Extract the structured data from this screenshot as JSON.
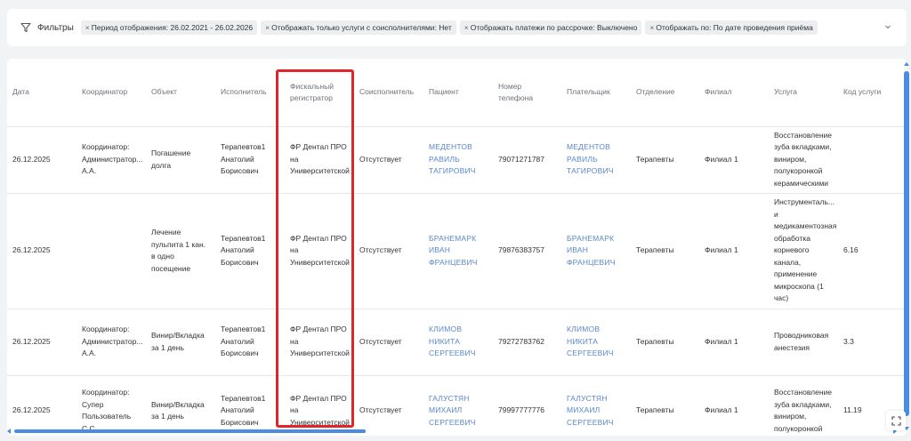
{
  "filters": {
    "title": "Фильтры",
    "chips": [
      "Период отображения: 26.02.2021 - 26.02.2026",
      "Отображать только услуги с соисполнителями: Нет",
      "Отображать платежи по рассрочке: Выключено",
      "Отображать по: По дате проведения приёма"
    ],
    "remove_glyph": "×",
    "icons": {
      "filter": "filter-funnel-icon",
      "toggle": "chevron-down-icon"
    }
  },
  "table": {
    "columns": [
      "Дата",
      "Координатор",
      "Объект",
      "Исполнитель",
      "Фискальный регистратор",
      "Соисполнитель",
      "Пациент",
      "Номер телефона",
      "Плательщик",
      "Отделение",
      "Филиал",
      "Услуга",
      "Код услуги"
    ],
    "rows": [
      {
        "date": "26.12.2025",
        "coordinator": "Координатор: Администратор... А.А.",
        "object": "Погашение долга",
        "executor": "Терапевтов1 Анатолий Борисович",
        "fiscal": "ФР Дентал ПРО на Университетской",
        "coexecutor": "Отсутствует",
        "patient": "МЕДЕНТОВ РАВИЛЬ ТАГИРОВИЧ",
        "phone": "79071271787",
        "payer": "МЕДЕНТОВ РАВИЛЬ ТАГИРОВИЧ",
        "department": "Терапевты",
        "branch": "Филиал 1",
        "service": "Восстановление зуба вкладками, виниром, полукоронкой керамическими",
        "code": ""
      },
      {
        "date": "26.12.2025",
        "coordinator": "",
        "object": "Лечение пульпита 1 кан. в одно посещение",
        "executor": "Терапевтов1 Анатолий Борисович",
        "fiscal": "ФР Дентал ПРО на Университетской",
        "coexecutor": "Отсутствует",
        "patient": "БРАНЕМАРК ИВАН ФРАНЦЕВИЧ",
        "phone": "79876383757",
        "payer": "БРАНЕМАРК ИВАН ФРАНЦЕВИЧ",
        "department": "Терапевты",
        "branch": "Филиал 1",
        "service": "Инструменталь... и медикаментозная обработка корневого канала, применение микроскопа (1 час)",
        "code": "6.16"
      },
      {
        "date": "26.12.2025",
        "coordinator": "Координатор: Администратор... А.А.",
        "object": "Винир/Вкладка за 1 день",
        "executor": "Терапевтов1 Анатолий Борисович",
        "fiscal": "ФР Дентал ПРО на Университетской",
        "coexecutor": "Отсутствует",
        "patient": "КЛИМОВ НИКИТА СЕРГЕЕВИЧ",
        "phone": "79272783762",
        "payer": "КЛИМОВ НИКИТА СЕРГЕЕВИЧ",
        "department": "Терапевты",
        "branch": "Филиал 1",
        "service": "Проводниковая анестезия",
        "code": "3.3"
      },
      {
        "date": "26.12.2025",
        "coordinator": "Координатор: Супер Пользователь С.С.",
        "object": "Винир/Вкладка за 1 день",
        "executor": "Терапевтов1 Анатолий Борисович",
        "fiscal": "ФР Дентал ПРО на Университетской",
        "coexecutor": "Отсутствует",
        "patient": "ГАЛУСТЯН МИХАИЛ СЕРГЕЕВИЧ",
        "phone": "79997777776",
        "payer": "ГАЛУСТЯН МИХАИЛ СЕРГЕЕВИЧ",
        "department": "Терапевты",
        "branch": "Филиал 1",
        "service": "Восстановление зуба вкладками, виниром, полукоронкой",
        "code": "11.19"
      }
    ]
  },
  "colors": {
    "link": "#5a87c8",
    "highlight": "#e0262b",
    "scrollbar": "#4a8cdf"
  },
  "icons": {
    "expand": "expand-icon"
  }
}
